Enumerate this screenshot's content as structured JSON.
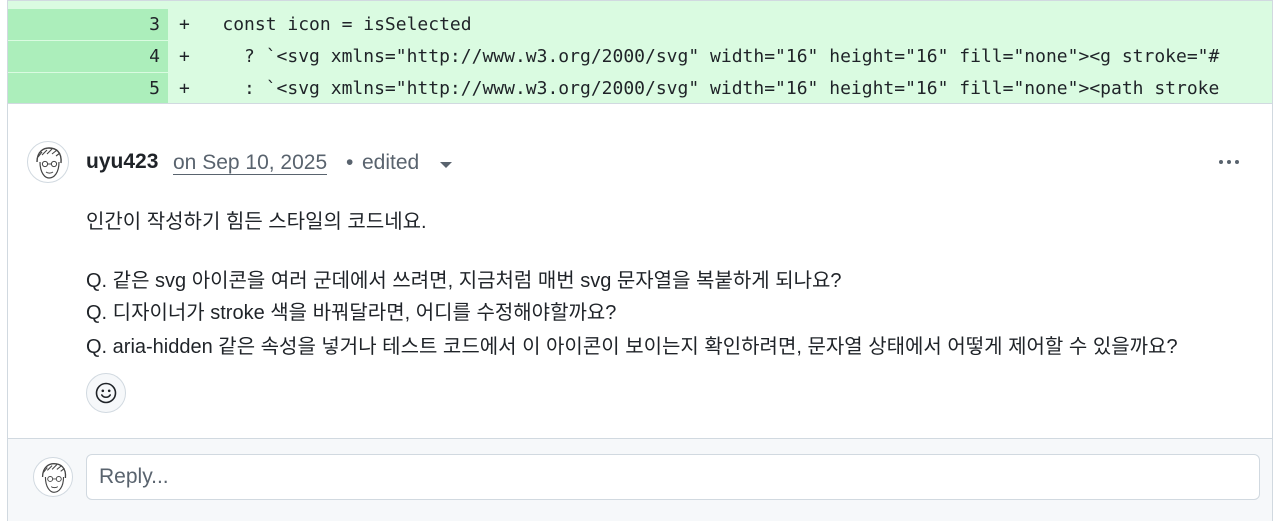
{
  "diff": {
    "lines": [
      {
        "number": "3",
        "sign": "+",
        "code": "  const icon = isSelected"
      },
      {
        "number": "4",
        "sign": "+",
        "code": "    ? `<svg xmlns=\"http://www.w3.org/2000/svg\" width=\"16\" height=\"16\" fill=\"none\"><g stroke=\"#"
      },
      {
        "number": "5",
        "sign": "+",
        "code": "    : `<svg xmlns=\"http://www.w3.org/2000/svg\" width=\"16\" height=\"16\" fill=\"none\"><path stroke"
      }
    ]
  },
  "comment": {
    "author": "uyu423",
    "date": "on Sep 10, 2025",
    "separator": "•",
    "edited": "edited",
    "body": [
      "인간이 작성하기 힘든 스타일의 코드네요.",
      "Q. 같은 svg 아이콘을 여러 군데에서 쓰려면, 지금처럼 매번 svg 문자열을 복붙하게 되나요?",
      "Q. 디자이너가 stroke 색을 바꿔달라면, 어디를 수정해야할까요?",
      "Q. aria-hidden 같은 속성을 넣거나 테스트 코드에서 이 아이콘이 보이는지 확인하려면, 문자열 상태에서 어떻게 제어할 수 있을까요?"
    ],
    "emoji_icon": "smiley-icon",
    "menu_icon": "kebab-horizontal-icon"
  },
  "reply": {
    "placeholder": "Reply..."
  },
  "colors": {
    "diff_bg": "#dafbe1",
    "diff_gutter": "#aceebb",
    "muted": "#59636e",
    "border": "#d1d9e0"
  }
}
